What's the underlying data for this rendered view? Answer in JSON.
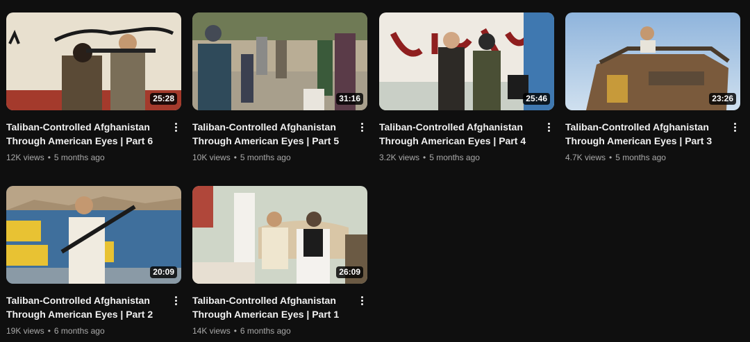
{
  "videos": [
    {
      "title_l1": "Taliban-Controlled Afghanistan",
      "title_l2": "Through American Eyes | Part 6",
      "duration": "25:28",
      "views": "12K views",
      "age": "5 months ago"
    },
    {
      "title_l1": "Taliban-Controlled Afghanistan",
      "title_l2": "Through American Eyes | Part 5",
      "duration": "31:16",
      "views": "10K views",
      "age": "5 months ago"
    },
    {
      "title_l1": "Taliban-Controlled Afghanistan",
      "title_l2": "Through American Eyes | Part 4",
      "duration": "25:46",
      "views": "3.2K views",
      "age": "5 months ago"
    },
    {
      "title_l1": "Taliban-Controlled Afghanistan",
      "title_l2": "Through American Eyes | Part 3",
      "duration": "23:26",
      "views": "4.7K views",
      "age": "5 months ago"
    },
    {
      "title_l1": "Taliban-Controlled Afghanistan",
      "title_l2": "Through American Eyes | Part 2",
      "duration": "20:09",
      "views": "19K views",
      "age": "6 months ago"
    },
    {
      "title_l1": "Taliban-Controlled Afghanistan",
      "title_l2": "Through American Eyes | Part 1",
      "duration": "26:09",
      "views": "14K views",
      "age": "6 months ago"
    }
  ],
  "separator": "•",
  "icons": {
    "more": "more-vert-icon"
  }
}
